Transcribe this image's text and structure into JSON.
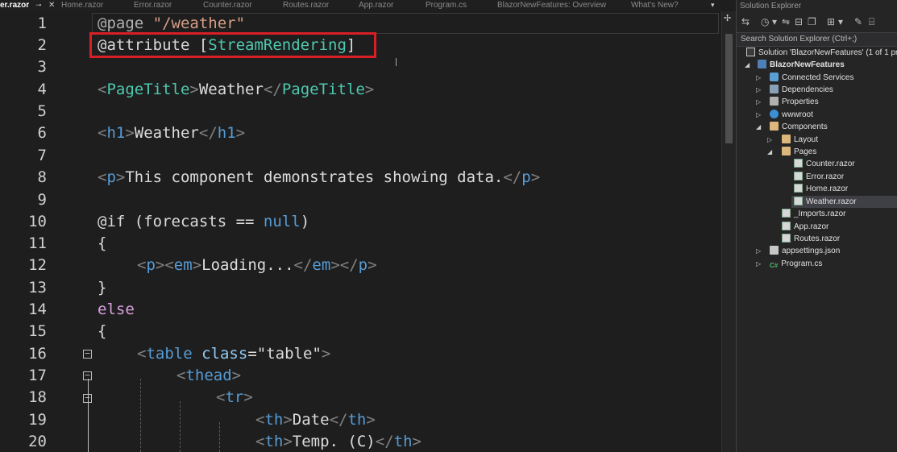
{
  "tabs": [
    {
      "label": "er.razor",
      "active": true
    },
    {
      "label": "Home.razor"
    },
    {
      "label": "Error.razor"
    },
    {
      "label": "Counter.razor"
    },
    {
      "label": "Routes.razor"
    },
    {
      "label": "App.razor"
    },
    {
      "label": "Program.cs"
    },
    {
      "label": "BlazorNewFeatures: Overview"
    },
    {
      "label": "What's New?"
    }
  ],
  "editor": {
    "line_numbers": [
      "1",
      "2",
      "3",
      "4",
      "5",
      "6",
      "7",
      "8",
      "9",
      "10",
      "11",
      "12",
      "13",
      "14",
      "15",
      "16",
      "17",
      "18",
      "19",
      "20"
    ],
    "lines": {
      "l1": {
        "at": "@page",
        "str": "\"/weather\""
      },
      "l2": {
        "at": "@attribute",
        "open": "[",
        "attr": "StreamRendering",
        "close": "]"
      },
      "l4": {
        "lt": "<",
        "tag": "PageTitle",
        "gt": ">",
        "text": "Weather",
        "lt2": "</",
        "tag2": "PageTitle",
        "gt2": ">"
      },
      "l6": {
        "lt": "<",
        "tag": "h1",
        "gt": ">",
        "text": "Weather",
        "lt2": "</",
        "tag2": "h1",
        "gt2": ">"
      },
      "l8": {
        "lt": "<",
        "tag": "p",
        "gt": ">",
        "text": "This component demonstrates showing data.",
        "lt2": "</",
        "tag2": "p",
        "gt2": ">"
      },
      "l10": {
        "at": "@if",
        "open": " (forecasts == ",
        "kw": "null",
        "close": ")"
      },
      "l11": {
        "text": "{"
      },
      "l12": {
        "lt": "<",
        "tag": "p",
        "gt": "><",
        "tag2": "em",
        "gt2": ">",
        "text": "Loading...",
        "lt3": "</",
        "tag3": "em",
        "gt3": "></",
        "tag4": "p",
        "gt4": ">"
      },
      "l13": {
        "text": "}"
      },
      "l14": {
        "text": "else"
      },
      "l15": {
        "text": "{"
      },
      "l16": {
        "lt": "<",
        "tag": "table",
        "sp": " ",
        "attr": "class",
        "eq": "=",
        "str": "\"table\"",
        "gt": ">"
      },
      "l17": {
        "lt": "<",
        "tag": "thead",
        "gt": ">"
      },
      "l18": {
        "lt": "<",
        "tag": "tr",
        "gt": ">"
      },
      "l19": {
        "lt": "<",
        "tag": "th",
        "gt": ">",
        "text": "Date",
        "lt2": "</",
        "tag2": "th",
        "gt2": ">"
      },
      "l20": {
        "lt": "<",
        "tag": "th",
        "gt": ">",
        "text": "Temp. (C)",
        "lt2": "</",
        "tag2": "th",
        "gt2": ">"
      }
    },
    "fold_markers": [
      "−",
      "−",
      "−"
    ]
  },
  "solution_explorer": {
    "title": "Solution Explorer",
    "search_placeholder": "Search Solution Explorer (Ctrl+;)",
    "nodes": [
      {
        "label": "Solution 'BlazorNewFeatures' (1 of 1 project)"
      },
      {
        "label": "BlazorNewFeatures"
      },
      {
        "label": "Connected Services"
      },
      {
        "label": "Dependencies"
      },
      {
        "label": "Properties"
      },
      {
        "label": "wwwroot"
      },
      {
        "label": "Components"
      },
      {
        "label": "Layout"
      },
      {
        "label": "Pages"
      },
      {
        "label": "Counter.razor"
      },
      {
        "label": "Error.razor"
      },
      {
        "label": "Home.razor"
      },
      {
        "label": "Weather.razor"
      },
      {
        "label": "_Imports.razor"
      },
      {
        "label": "App.razor"
      },
      {
        "label": "Routes.razor"
      },
      {
        "label": "appsettings.json"
      },
      {
        "label": "Program.cs"
      }
    ]
  },
  "colors": {
    "accent_highlight": "#d81f26",
    "editor_bg": "#1e1e1e",
    "tag": "#4ec9b0",
    "keyword": "#569cd6"
  }
}
